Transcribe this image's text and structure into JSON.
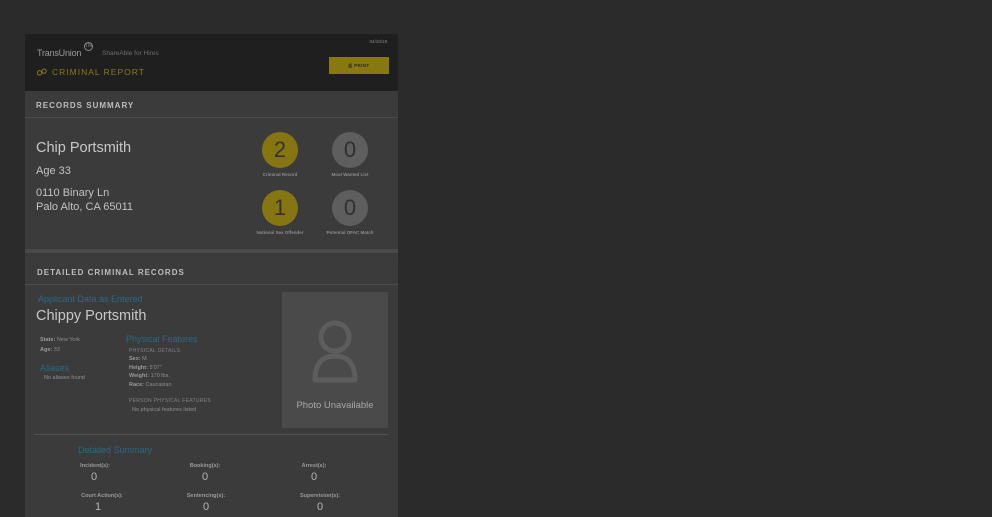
{
  "header": {
    "brand": "TransUnion",
    "brand_mark": "TM",
    "tagline": "ShareAble for Hires",
    "report_title": "CRIMINAL REPORT",
    "date": "04/10/18",
    "print_label": "PRINT"
  },
  "summary": {
    "title": "RECORDS SUMMARY",
    "name": "Chip Portsmith",
    "age": "Age 33",
    "address1": "0110 Binary Ln",
    "address2": "Palo Alto, CA  65011",
    "stats": [
      {
        "value": "2",
        "label": "Criminal Record"
      },
      {
        "value": "0",
        "label": "Most Wanted List"
      },
      {
        "value": "1",
        "label": "National Sex Offender"
      },
      {
        "value": "0",
        "label": "Potential OFAC Match"
      }
    ]
  },
  "detailed": {
    "title": "DETAILED CRIMINAL RECORDS",
    "applicant_heading": "Applicant Data as Entered",
    "name": "Chippy Portsmith",
    "state_label": "State:",
    "state_value": "New York",
    "age_label": "Age:",
    "age_value": "33",
    "aliases_heading": "Aliases",
    "aliases_value": "No aliases found",
    "physical_heading": "Physical Features",
    "physical_details_label": "PHYSICAL DETAILS",
    "sex_label": "Sex:",
    "sex_value": "M",
    "height_label": "Height:",
    "height_value": "5'07\"",
    "weight_label": "Weight:",
    "weight_value": "170 lbs.",
    "race_label": "Race:",
    "race_value": "Caucasian",
    "person_features_label": "PERSON PHYSICAL FEATURES",
    "person_features_value": "No physical features listed",
    "photo_label": "Photo Unavailable",
    "detailed_summary_heading": "Detailed Summary",
    "summary_stats": [
      {
        "label": "Incident(s):",
        "value": "0"
      },
      {
        "label": "Booking(s):",
        "value": "0"
      },
      {
        "label": "Arrest(s):",
        "value": "0"
      },
      {
        "label": "Court Action(s):",
        "value": "1"
      },
      {
        "label": "Sentencing(s):",
        "value": "0"
      },
      {
        "label": "Supervision(s):",
        "value": "0"
      }
    ]
  },
  "colors": {
    "accent_gold": "#857611",
    "heading_blue": "#2a6a85",
    "overlay": "#2b2b2b"
  }
}
